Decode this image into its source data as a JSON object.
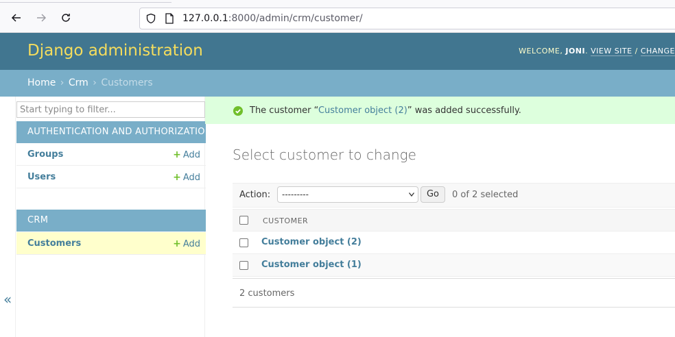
{
  "browser": {
    "url_host": "127.0.0.1",
    "url_path": ":8000/admin/crm/customer/"
  },
  "header": {
    "branding": "Django administration",
    "welcome": "WELCOME, ",
    "username": "JONI",
    "view_site": "VIEW SITE",
    "separator": " / ",
    "change_password": "CHANGE"
  },
  "breadcrumbs": {
    "home": "Home",
    "app": "Crm",
    "current": "Customers",
    "sep": "›"
  },
  "sidebar": {
    "filter_placeholder": "Start typing to filter...",
    "modules": [
      {
        "caption": "AUTHENTICATION AND AUTHORIZATION",
        "models": [
          {
            "name": "Groups",
            "add": "Add"
          },
          {
            "name": "Users",
            "add": "Add"
          }
        ]
      },
      {
        "caption": "CRM",
        "models": [
          {
            "name": "Customers",
            "add": "Add"
          }
        ]
      }
    ],
    "toggle": "«"
  },
  "message": {
    "prefix": "The customer “",
    "link": "Customer object (2)",
    "suffix": "” was added successfully."
  },
  "content": {
    "title": "Select customer to change",
    "action_label": "Action:",
    "action_selected": "---------",
    "go": "Go",
    "selected_count": "0 of 2 selected",
    "column_header": "CUSTOMER",
    "rows": [
      "Customer object (2)",
      "Customer object (1)"
    ],
    "paginator": "2 customers"
  },
  "colors": {
    "header_bg": "#417690",
    "breadcrumbs_bg": "#79aec8",
    "branding": "#f5dd5d",
    "link": "#447e9b",
    "success_bg": "#ddffdd",
    "current_row": "#ffffcc"
  }
}
